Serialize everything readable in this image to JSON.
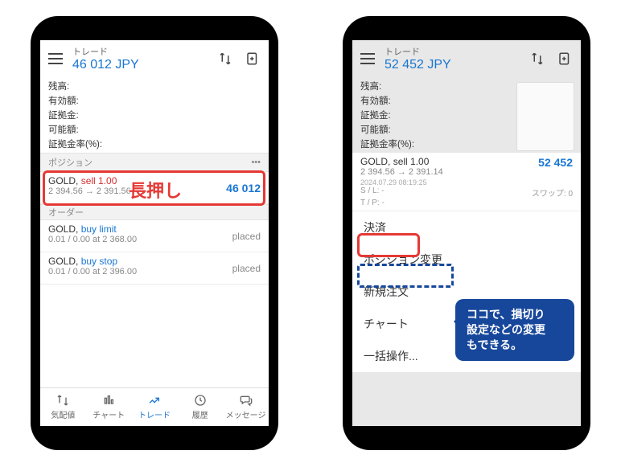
{
  "phones": [
    {
      "header": {
        "title": "トレード",
        "amount": "46 012 JPY"
      },
      "summary": [
        "残高:",
        "有効額:",
        "証拠金:",
        "可能額:",
        "証拠金率(%):"
      ],
      "sections": {
        "positions_label": "ポジション",
        "orders_label": "オーダー"
      },
      "position": {
        "symbol": "GOLD,",
        "side": "sell 1.00",
        "prices": "2 394.56 → 2 391.56",
        "pnl": "46 012"
      },
      "orders": [
        {
          "symbol": "GOLD,",
          "side": "buy limit",
          "detail": "0.01 / 0.00 at 2 368.00",
          "status": "placed"
        },
        {
          "symbol": "GOLD,",
          "side": "buy stop",
          "detail": "0.01 / 0.00 at 2 396.00",
          "status": "placed"
        }
      ],
      "nav": [
        "気配値",
        "チャート",
        "トレード",
        "履歴",
        "メッセージ"
      ],
      "callout": "長押し"
    },
    {
      "header": {
        "title": "トレード",
        "amount": "52 452 JPY"
      },
      "summary": [
        "残高:",
        "有効額:",
        "証拠金:",
        "可能額:",
        "証拠金率(%):"
      ],
      "position": {
        "symbol": "GOLD,",
        "side": "sell 1.00",
        "prices": "2 394.56 → 2 391.14",
        "pnl": "52 452",
        "time": "2024.07.29 08:19:25",
        "sl_label": "S / L:",
        "sl_val": "-",
        "swap_label": "スワップ:",
        "swap_val": "0",
        "tp_label": "T / P:",
        "tp_val": "-"
      },
      "menu": [
        "決済",
        "ポジション変更",
        "新規注文",
        "チャート",
        "一括操作..."
      ],
      "tooltip": "ココで、損切り\n設定などの変更\nもできる。"
    }
  ]
}
